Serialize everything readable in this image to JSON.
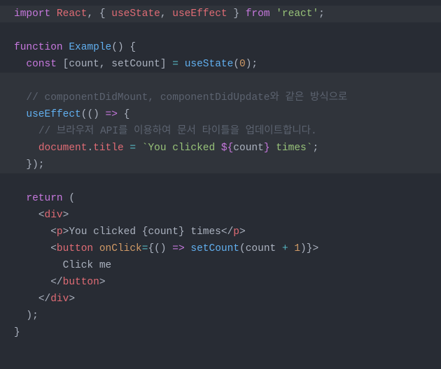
{
  "code": {
    "l1_import": "import",
    "l1_react": "React",
    "l1_comma": ",",
    "l1_brace_open": "{",
    "l1_useState": "useState",
    "l1_comma2": ",",
    "l1_useEffect": "useEffect",
    "l1_brace_close": "}",
    "l1_from": "from",
    "l1_string": "'react'",
    "l1_semi": ";",
    "l3_function": "function",
    "l3_name": "Example",
    "l3_parens": "()",
    "l3_brace": "{",
    "l4_const": "const",
    "l4_bracket_open": "[",
    "l4_count": "count",
    "l4_comma": ",",
    "l4_setCount": "setCount",
    "l4_bracket_close": "]",
    "l4_eq": "=",
    "l4_useState": "useState",
    "l4_paren_open": "(",
    "l4_zero": "0",
    "l4_paren_close": ")",
    "l4_semi": ";",
    "l6_comment": "// componentDidMount, componentDidUpdate와 같은 방식으로",
    "l7_useEffect": "useEffect",
    "l7_paren_open": "(",
    "l7_arrow_parens": "()",
    "l7_arrow": "=>",
    "l7_brace": "{",
    "l8_comment": "// 브라우저 API를 이용하여 문서 타이틀을 업데이트합니다.",
    "l9_document": "document",
    "l9_dot": ".",
    "l9_title": "title",
    "l9_eq": "=",
    "l9_backtick_open": "`",
    "l9_str1": "You clicked ",
    "l9_interp_open": "${",
    "l9_count": "count",
    "l9_interp_close": "}",
    "l9_str2": " times",
    "l9_backtick_close": "`",
    "l9_semi": ";",
    "l10_close": "});",
    "l12_return": "return",
    "l12_paren": "(",
    "l13_div_open_lt": "<",
    "l13_div": "div",
    "l13_div_open_gt": ">",
    "l14_p_open_lt": "<",
    "l14_p": "p",
    "l14_p_open_gt": ">",
    "l14_text1": "You clicked ",
    "l14_brace_open": "{",
    "l14_count": "count",
    "l14_brace_close": "}",
    "l14_text2": " times",
    "l14_p_close_lt": "</",
    "l14_p_close": "p",
    "l14_p_close_gt": ">",
    "l15_btn_open_lt": "<",
    "l15_btn": "button",
    "l15_onClick": "onClick",
    "l15_eq": "=",
    "l15_brace_open": "{",
    "l15_arrow_parens": "()",
    "l15_arrow": "=>",
    "l15_setCount": "setCount",
    "l15_paren_open": "(",
    "l15_count": "count",
    "l15_plus": "+",
    "l15_one": "1",
    "l15_paren_close": ")",
    "l15_brace_close": "}",
    "l15_gt": ">",
    "l16_text": "Click me",
    "l17_btn_close_lt": "</",
    "l17_btn": "button",
    "l17_btn_close_gt": ">",
    "l18_div_close_lt": "</",
    "l18_div": "div",
    "l18_div_close_gt": ">",
    "l19_close": ");",
    "l20_close": "}"
  }
}
